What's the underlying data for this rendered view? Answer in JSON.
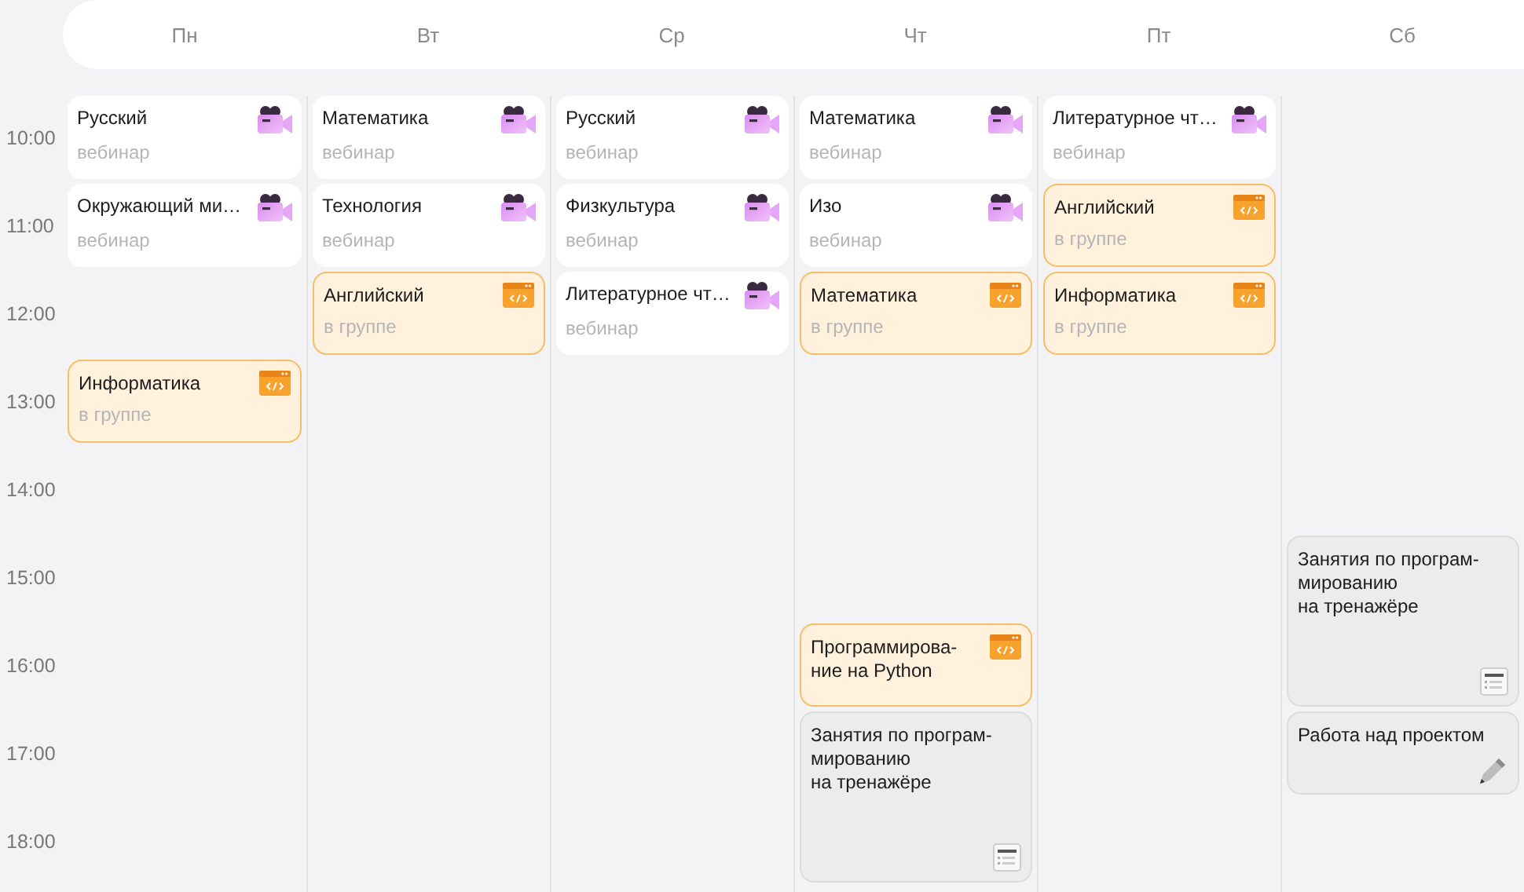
{
  "days": [
    {
      "label": "Пн",
      "events": [
        {
          "title": "Русский",
          "subtitle": "вебинар",
          "kind": "webinar",
          "long": false
        },
        {
          "title": "Окружающий ми…",
          "subtitle": "вебинар",
          "kind": "webinar",
          "long": false
        },
        {
          "kind": "gap"
        },
        {
          "title": "Информатика",
          "subtitle": "в группе",
          "kind": "group",
          "long": false
        }
      ]
    },
    {
      "label": "Вт",
      "events": [
        {
          "title": "Математика",
          "subtitle": "вебинар",
          "kind": "webinar",
          "long": false
        },
        {
          "title": "Технология",
          "subtitle": "вебинар",
          "kind": "webinar",
          "long": false
        },
        {
          "title": "Английский",
          "subtitle": "в группе",
          "kind": "group",
          "long": false
        }
      ]
    },
    {
      "label": "Ср",
      "events": [
        {
          "title": "Русский",
          "subtitle": "вебинар",
          "kind": "webinar",
          "long": false
        },
        {
          "title": "Физкультура",
          "subtitle": "вебинар",
          "kind": "webinar",
          "long": false
        },
        {
          "title": "Литературное чт…",
          "subtitle": "вебинар",
          "kind": "webinar",
          "long": false
        }
      ]
    },
    {
      "label": "Чт",
      "events": [
        {
          "title": "Математика",
          "subtitle": "вебинар",
          "kind": "webinar",
          "long": false
        },
        {
          "title": "Изо",
          "subtitle": "вебинар",
          "kind": "webinar",
          "long": false
        },
        {
          "title": "Математика",
          "subtitle": "в группе",
          "kind": "group",
          "long": false
        },
        {
          "kind": "gap"
        },
        {
          "kind": "gap"
        },
        {
          "kind": "gap"
        },
        {
          "title": "Программирова-\nние на Python",
          "kind": "group",
          "long": false
        },
        {
          "title": "Занятия по програм-\nмированию\nна тренажёре",
          "kind": "trainer",
          "long": true
        }
      ]
    },
    {
      "label": "Пт",
      "events": [
        {
          "title": "Литературное чт…",
          "subtitle": "вебинар",
          "kind": "webinar",
          "long": false
        },
        {
          "title": "Английский",
          "subtitle": "в группе",
          "kind": "group",
          "long": false
        },
        {
          "title": "Информатика",
          "subtitle": "в группе",
          "kind": "group",
          "long": false
        }
      ]
    },
    {
      "label": "Сб",
      "events": [
        {
          "kind": "gap"
        },
        {
          "kind": "gap"
        },
        {
          "kind": "gap"
        },
        {
          "kind": "gap"
        },
        {
          "kind": "gap"
        },
        {
          "title": "Занятия по програм-\nмированию\nна тренажёре",
          "kind": "trainer",
          "long": true
        },
        {
          "title": "Работа над проектом",
          "kind": "project",
          "long": false
        }
      ]
    }
  ],
  "times": [
    "10:00",
    "11:00",
    "12:00",
    "13:00",
    "14:00",
    "15:00",
    "16:00",
    "17:00",
    "18:00"
  ]
}
